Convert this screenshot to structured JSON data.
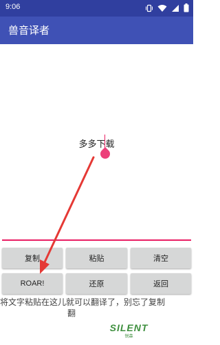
{
  "status_bar": {
    "time": "9:06",
    "icons": [
      "vibrate-icon",
      "wifi-icon",
      "cell-signal-icon",
      "battery-icon"
    ]
  },
  "app_bar": {
    "title": "兽音译者"
  },
  "input": {
    "text": "多多下载"
  },
  "buttons": {
    "copy": "复制",
    "paste": "粘贴",
    "clear": "清空",
    "roar": "ROAR!",
    "restore": "还原",
    "back": "返回"
  },
  "hint": {
    "line1": "将文字粘贴在这儿就可以翻译了，别忘了复制",
    "line2": "翻"
  },
  "watermark": {
    "word": "SILENT",
    "sub": "锐森"
  },
  "colors": {
    "status_bar": "#303f9f",
    "app_bar": "#3f51b5",
    "accent": "#e91e63",
    "button": "#d6d7d7",
    "annotation_arrow": "#e53935"
  }
}
